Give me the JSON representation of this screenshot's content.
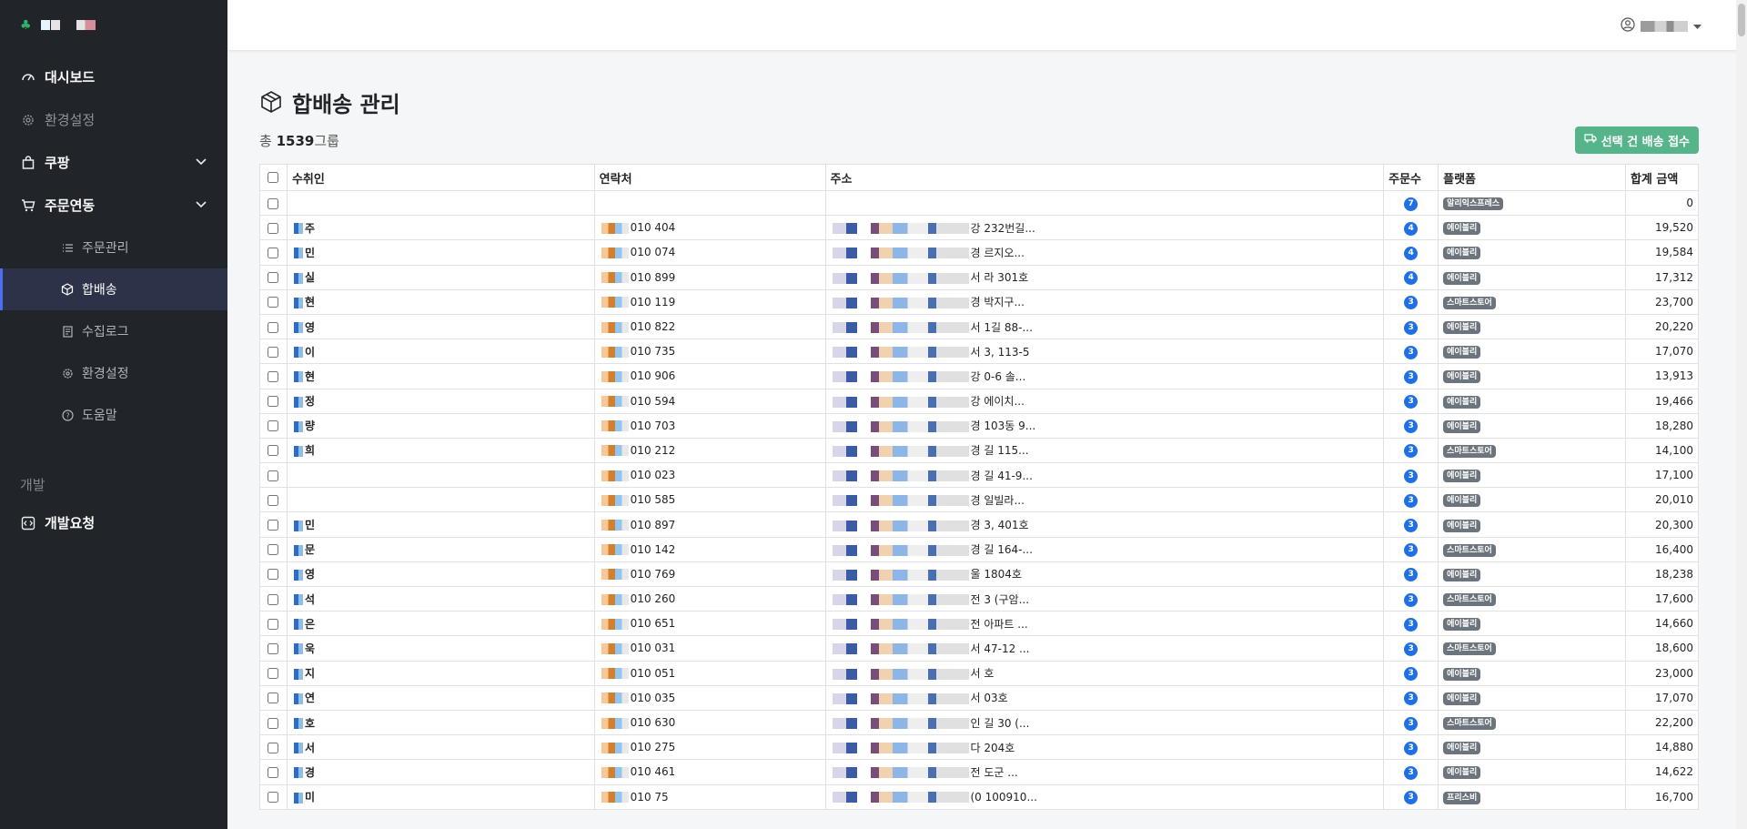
{
  "sidebar": {
    "items": [
      {
        "label": "대시보드",
        "icon": "speedometer-icon"
      },
      {
        "label": "환경설정",
        "icon": "gear-icon"
      },
      {
        "label": "쿠팡",
        "icon": "bag-icon"
      },
      {
        "label": "주문연동",
        "icon": "cart-icon"
      }
    ],
    "sub_items": [
      {
        "label": "주문관리",
        "icon": "list-icon"
      },
      {
        "label": "합배송",
        "icon": "box-icon",
        "active": true
      },
      {
        "label": "수집로그",
        "icon": "log-icon"
      },
      {
        "label": "환경설정",
        "icon": "gear-icon"
      },
      {
        "label": "도움말",
        "icon": "question-icon"
      }
    ],
    "section_label": "개발",
    "dev_item": {
      "label": "개발요청",
      "icon": "code-icon"
    }
  },
  "page": {
    "title": "합배송 관리",
    "count_prefix": "총",
    "count_value": "1539",
    "count_suffix": "그룹",
    "action_button": "선택 건 배송 접수"
  },
  "table": {
    "headers": [
      "수취인",
      "연락처",
      "주소",
      "주문수",
      "플랫폼",
      "합계 금액"
    ],
    "rows": [
      {
        "name": "",
        "phone": "",
        "addr": "",
        "cnt": "7",
        "plat": "알리익스프레스",
        "amt": "0"
      },
      {
        "name": "주",
        "phone": "010 404",
        "addr": "강 232번길...",
        "cnt": "4",
        "plat": "에이블리",
        "amt": "19,520"
      },
      {
        "name": "민",
        "phone": "010 074",
        "addr": "경 르지오...",
        "cnt": "4",
        "plat": "에이블리",
        "amt": "19,584"
      },
      {
        "name": "실",
        "phone": "010 899",
        "addr": "서 라 301호",
        "cnt": "4",
        "plat": "에이블리",
        "amt": "17,312"
      },
      {
        "name": "현",
        "phone": "010 119",
        "addr": "경 박지구...",
        "cnt": "3",
        "plat": "스마트스토어",
        "amt": "23,700"
      },
      {
        "name": "영",
        "phone": "010 822",
        "addr": "서 1길 88-...",
        "cnt": "3",
        "plat": "에이블리",
        "amt": "20,220"
      },
      {
        "name": "이",
        "phone": "010 735",
        "addr": "서 3, 113-5",
        "cnt": "3",
        "plat": "에이블리",
        "amt": "17,070"
      },
      {
        "name": "현",
        "phone": "010 906",
        "addr": "강 0-6 솔...",
        "cnt": "3",
        "plat": "에이블리",
        "amt": "13,913"
      },
      {
        "name": "정",
        "phone": "010 594",
        "addr": "강 에이치...",
        "cnt": "3",
        "plat": "에이블리",
        "amt": "19,466"
      },
      {
        "name": "량",
        "phone": "010 703",
        "addr": "경 103동 9...",
        "cnt": "3",
        "plat": "에이블리",
        "amt": "18,280"
      },
      {
        "name": "희",
        "phone": "010 212",
        "addr": "경 길 115...",
        "cnt": "3",
        "plat": "스마트스토어",
        "amt": "14,100"
      },
      {
        "name": "",
        "phone": "010 023",
        "addr": "경 길 41-9...",
        "cnt": "3",
        "plat": "에이블리",
        "amt": "17,100"
      },
      {
        "name": "",
        "phone": "010 585",
        "addr": "경 일빌라...",
        "cnt": "3",
        "plat": "에이블리",
        "amt": "20,010"
      },
      {
        "name": "민",
        "phone": "010 897",
        "addr": "경 3, 401호",
        "cnt": "3",
        "plat": "에이블리",
        "amt": "20,300"
      },
      {
        "name": "문",
        "phone": "010 142",
        "addr": "경 길 164-...",
        "cnt": "3",
        "plat": "스마트스토어",
        "amt": "16,400"
      },
      {
        "name": "영",
        "phone": "010 769",
        "addr": "울 1804호",
        "cnt": "3",
        "plat": "에이블리",
        "amt": "18,238"
      },
      {
        "name": "석",
        "phone": "010 260",
        "addr": "전 3 (구암...",
        "cnt": "3",
        "plat": "스마트스토어",
        "amt": "17,600"
      },
      {
        "name": "은",
        "phone": "010 651",
        "addr": "전 아파트 ...",
        "cnt": "3",
        "plat": "에이블리",
        "amt": "14,660"
      },
      {
        "name": "욱",
        "phone": "010 031",
        "addr": "서 47-12 ...",
        "cnt": "3",
        "plat": "스마트스토어",
        "amt": "18,600"
      },
      {
        "name": "지",
        "phone": "010 051",
        "addr": "서 호",
        "cnt": "3",
        "plat": "에이블리",
        "amt": "23,000"
      },
      {
        "name": "연",
        "phone": "010 035",
        "addr": "서 03호",
        "cnt": "3",
        "plat": "에이블리",
        "amt": "17,070"
      },
      {
        "name": "호",
        "phone": "010 630",
        "addr": "인 길 30 (...",
        "cnt": "3",
        "plat": "스마트스토어",
        "amt": "22,200"
      },
      {
        "name": "서",
        "phone": "010 275",
        "addr": "다 204호",
        "cnt": "3",
        "plat": "에이블리",
        "amt": "14,880"
      },
      {
        "name": "경",
        "phone": "010 461",
        "addr": "전 도군 ...",
        "cnt": "3",
        "plat": "에이블리",
        "amt": "14,622"
      },
      {
        "name": "미",
        "phone": "010 75",
        "addr": "(0 100910...",
        "cnt": "3",
        "plat": "프리스비",
        "amt": "16,700"
      }
    ]
  },
  "colors": {
    "sidebar_bg": "#212529",
    "active_bg": "#2c3349",
    "accent": "#1f6fe5",
    "green_button": "#56b48b"
  }
}
